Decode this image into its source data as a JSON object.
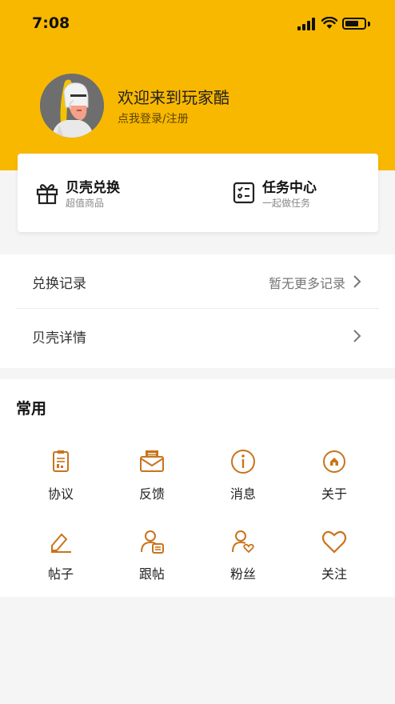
{
  "status_bar": {
    "time": "7:08"
  },
  "profile": {
    "welcome": "欢迎来到玩家酷",
    "login_prompt": "点我登录/注册"
  },
  "quick_actions": [
    {
      "title": "贝壳兑换",
      "subtitle": "超值商品",
      "icon": "gift-icon"
    },
    {
      "title": "任务中心",
      "subtitle": "一起做任务",
      "icon": "task-list-icon"
    }
  ],
  "records": {
    "exchange_label": "兑换记录",
    "exchange_value": "暂无更多记录",
    "shell_detail_label": "贝壳详情"
  },
  "common": {
    "title": "常用",
    "items": [
      {
        "label": "协议",
        "icon": "document-icon"
      },
      {
        "label": "反馈",
        "icon": "envelope-icon"
      },
      {
        "label": "消息",
        "icon": "info-icon"
      },
      {
        "label": "关于",
        "icon": "home-icon"
      },
      {
        "label": "帖子",
        "icon": "edit-icon"
      },
      {
        "label": "跟帖",
        "icon": "user-comment-icon"
      },
      {
        "label": "粉丝",
        "icon": "user-heart-icon"
      },
      {
        "label": "关注",
        "icon": "heart-icon"
      }
    ]
  },
  "colors": {
    "brand": "#f9b800",
    "icon_accent": "#c9741c"
  }
}
